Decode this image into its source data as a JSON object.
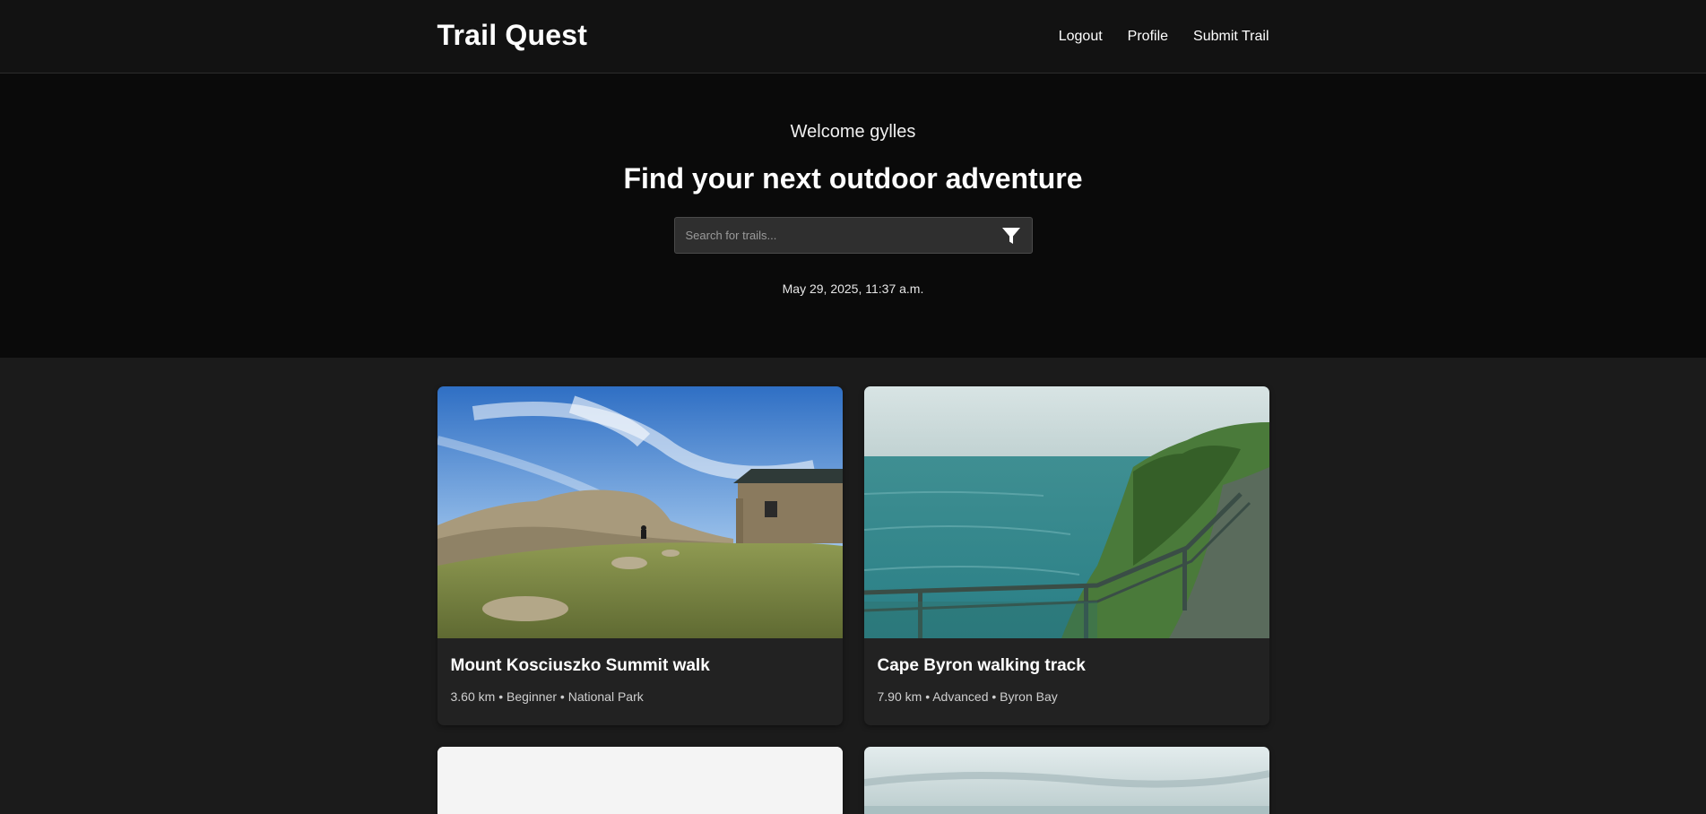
{
  "header": {
    "brand": "Trail Quest",
    "nav": [
      {
        "label": "Logout"
      },
      {
        "label": "Profile"
      },
      {
        "label": "Submit Trail"
      }
    ]
  },
  "hero": {
    "welcome": "Welcome gylles",
    "title": "Find your next outdoor adventure",
    "search_placeholder": "Search for trails...",
    "filter_icon": "filter-icon",
    "timestamp": "May 29, 2025, 11:37 a.m."
  },
  "trails": [
    {
      "title": "Mount Kosciuszko Summit walk",
      "meta": "3.60 km • Beginner • National Park",
      "image": "mountain-hut-landscape"
    },
    {
      "title": "Cape Byron walking track",
      "meta": "7.90 km • Advanced • Byron Bay",
      "image": "coastal-boardwalk-landscape"
    },
    {
      "title": "",
      "meta": "",
      "image": "blank-placeholder"
    },
    {
      "title": "",
      "meta": "",
      "image": "overcast-sea-landscape"
    }
  ],
  "colors": {
    "header_bg": "#121212",
    "hero_bg": "#0a0a0a",
    "page_bg": "#1b1b1b",
    "card_bg": "#222222"
  }
}
